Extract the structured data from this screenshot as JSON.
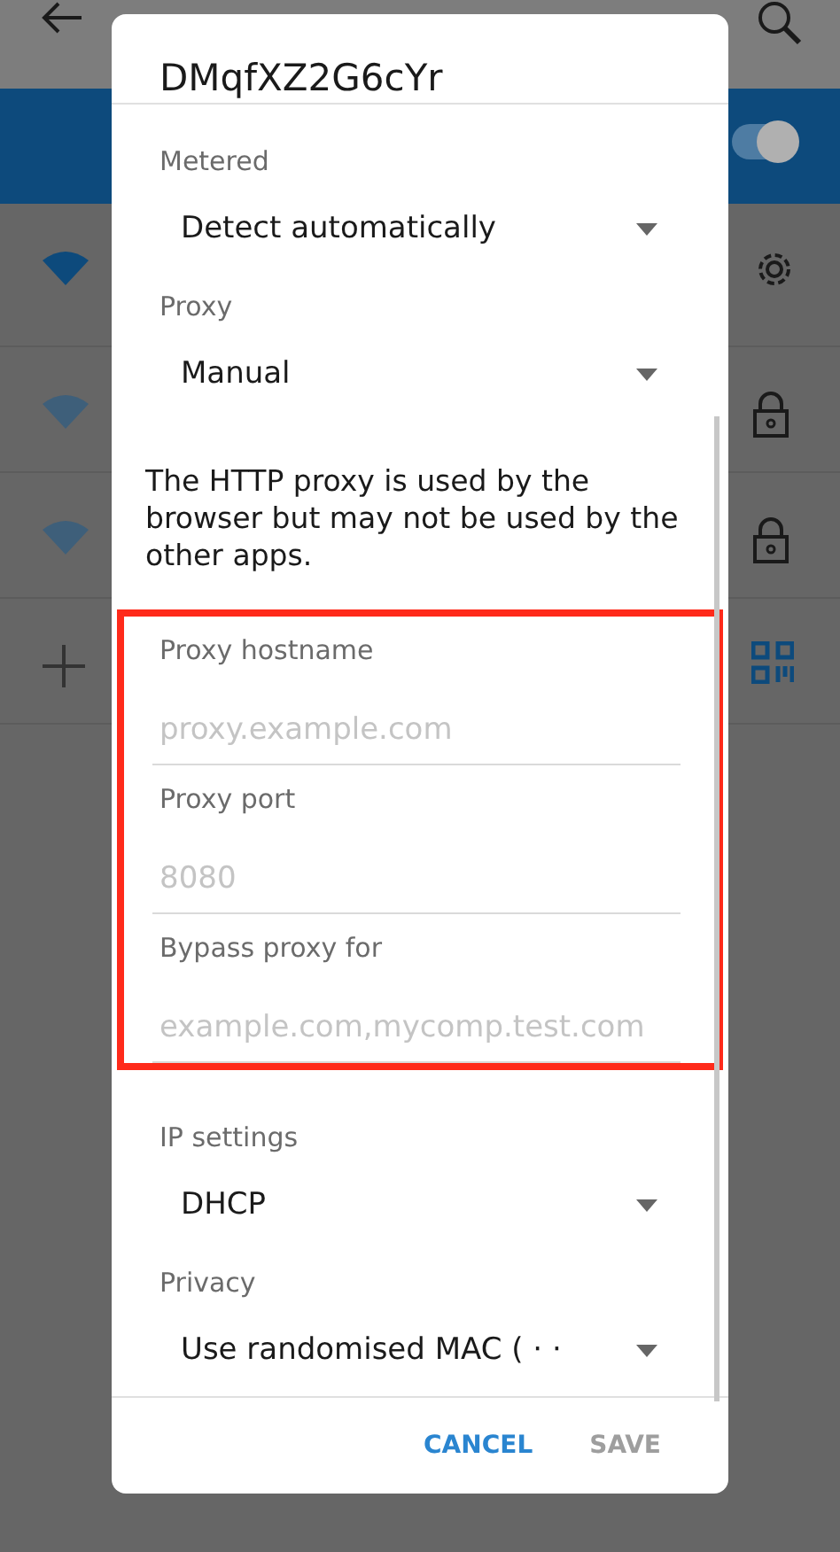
{
  "background": {
    "wifi_switch": {
      "on": true
    },
    "networks": [
      {
        "kind": "connected"
      },
      {
        "kind": "locked"
      },
      {
        "kind": "locked"
      },
      {
        "kind": "add"
      }
    ]
  },
  "dialog": {
    "title": "DMqfXZ2G6cYr",
    "top_spinners": [
      {
        "label": "Metered",
        "value": "Detect automatically"
      },
      {
        "label": "Proxy",
        "value": "Manual"
      }
    ],
    "note": "The HTTP proxy is used by the browser but may not be used by the other apps.",
    "fields_highlighted": true,
    "fields": [
      {
        "label": "Proxy hostname",
        "placeholder": "proxy.example.com"
      },
      {
        "label": "Proxy port",
        "placeholder": "8080"
      },
      {
        "label": "Bypass proxy for",
        "placeholder": "example.com,mycomp.test.com"
      }
    ],
    "bottom_spinners": [
      {
        "label": "IP settings",
        "value": "DHCP"
      },
      {
        "label": "Privacy",
        "value": "Use randomised MAC ( · ·"
      }
    ],
    "buttons": [
      {
        "label": "CANCEL",
        "disabled": false
      },
      {
        "label": "SAVE",
        "disabled": true
      }
    ]
  }
}
